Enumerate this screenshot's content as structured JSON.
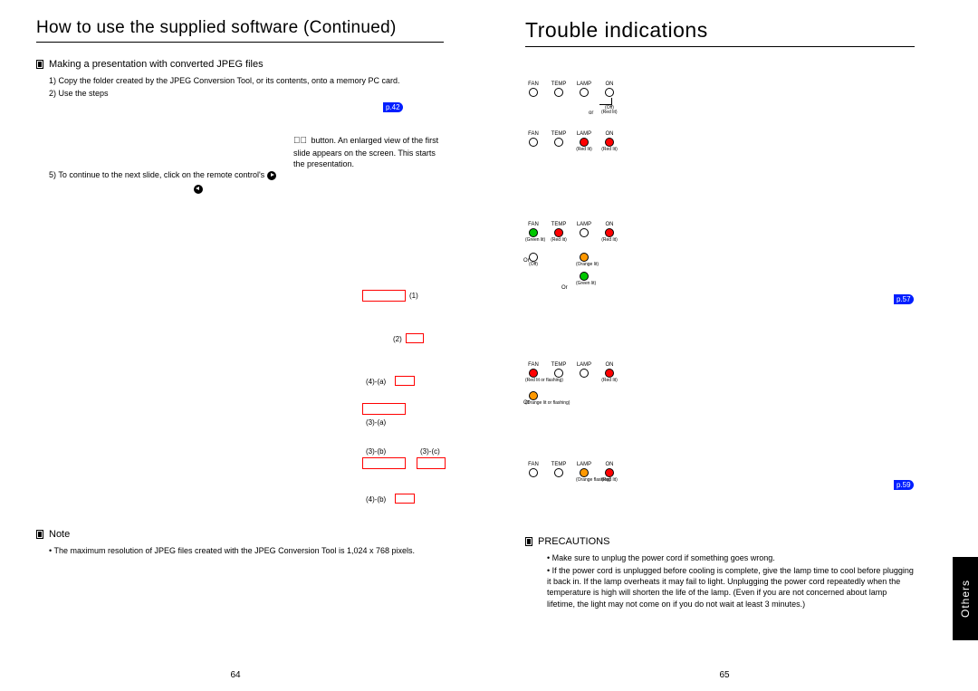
{
  "left": {
    "title": "How to use the supplied software (Continued)",
    "section": "Making a presentation with converted JPEG files",
    "steps": {
      "s1": "1) Copy the folder created by the JPEG Conversion Tool, or its contents, onto a memory PC card.",
      "s2": "2) Use the steps",
      "ref2": "p.42",
      "s3a": " button. An enlarged view of the first slide appears on the screen. This starts the presentation.",
      "s3b": "5) To continue to the next slide, click on the remote control's "
    },
    "note_h": "Note",
    "note_b": "The maximum resolution of JPEG files created with the JPEG Conversion Tool is 1,024 x 768 pixels.",
    "dia_labels": {
      "l1": "(1)",
      "l2": "(2)",
      "l4a": "(4)-(a)",
      "l3a": "(3)-(a)",
      "l3b": "(3)-(b)",
      "l3c": "(3)-(c)",
      "l4b": "(4)-(b)"
    },
    "page_num": "64"
  },
  "right": {
    "title": "Trouble indications",
    "led_labels": {
      "fan": "FAN",
      "temp": "TEMP",
      "lamp": "LAMP",
      "on": "ON"
    },
    "states": {
      "off": "(Off)",
      "redlit": "(Red lit)",
      "greenlit": "(Green lit)",
      "orangelit": "(Orange lit)",
      "redflash": "(Red lit or flashing)",
      "orangeflash": "(Orange lit or flashing)",
      "orange_flashing": "(Orange flashing)",
      "or": "or",
      "Or": "Or"
    },
    "ref57": "p.57",
    "ref59": "p.59",
    "prec_h": "PRECAUTIONS",
    "prec1": "Make sure to unplug the power cord if something goes wrong.",
    "prec2": "If the power cord is unplugged before cooling is complete, give the lamp time to cool before plugging it back in. If the lamp overheats it may fail to light. Unplugging the power cord repeatedly when the temperature is high will shorten the life of the lamp. (Even if you are not concerned about lamp lifetime, the light may not come on if you do not wait at least 3 minutes.)",
    "page_num": "65"
  },
  "side_tab": "Others"
}
